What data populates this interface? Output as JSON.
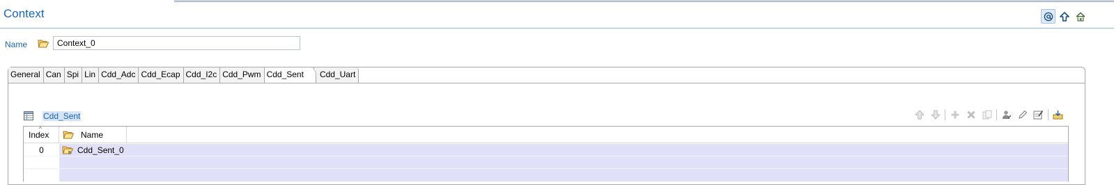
{
  "header": {
    "title": "Context",
    "tools": [
      {
        "icon": "at-sign-icon",
        "selected": true
      },
      {
        "icon": "up-arrow-icon",
        "selected": false
      },
      {
        "icon": "home-icon",
        "selected": false
      }
    ]
  },
  "name_field": {
    "label": "Name",
    "value": "Context_0",
    "icon": "folder-open-icon"
  },
  "tabs": [
    {
      "label": "General"
    },
    {
      "label": "Can"
    },
    {
      "label": "Spi"
    },
    {
      "label": "Lin"
    },
    {
      "label": "Cdd_Adc"
    },
    {
      "label": "Cdd_Ecap"
    },
    {
      "label": "Cdd_I2c"
    },
    {
      "label": "Cdd_Pwm"
    },
    {
      "label": "Cdd_Sent",
      "active": true
    },
    {
      "label": "Cdd_Uart"
    }
  ],
  "section": {
    "title": "Cdd_Sent",
    "icon": "table-icon",
    "toolbar": [
      "move-up-icon",
      "move-down-icon",
      "add-icon",
      "delete-icon",
      "copy-icon",
      "user-edit-icon",
      "pencil-icon",
      "edit-form-icon",
      "import-icon"
    ]
  },
  "table": {
    "columns": [
      "Index",
      "Name"
    ],
    "rows": [
      {
        "index": "0",
        "name": "Cdd_Sent_0"
      }
    ],
    "row_highlight_color": "#e0e0f8"
  },
  "colors": {
    "accent": "#1a66b0"
  }
}
